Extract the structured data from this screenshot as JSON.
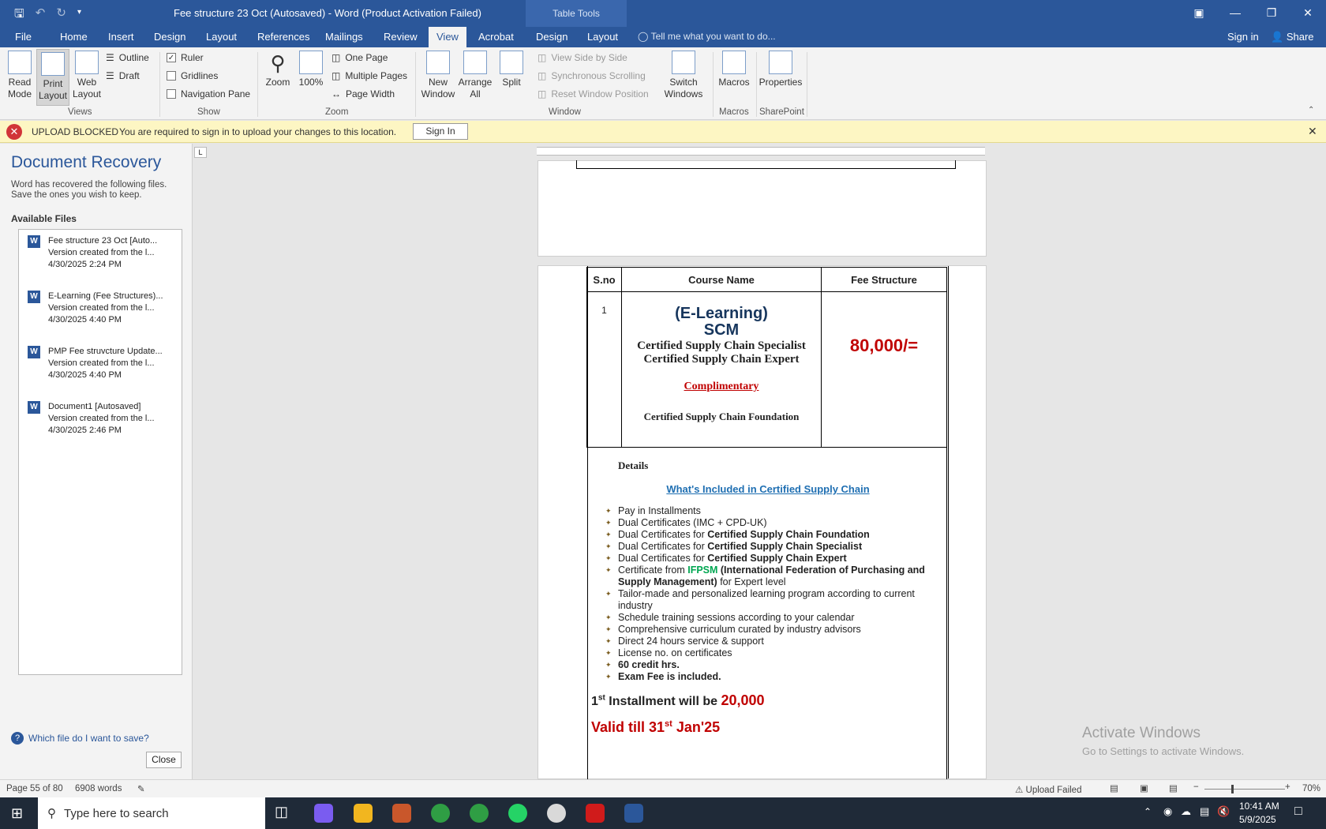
{
  "titlebar": {
    "title": "Fee structure 23 Oct (Autosaved) - Word (Product Activation Failed)",
    "table_tools": "Table Tools"
  },
  "tabs": [
    "File",
    "Home",
    "Insert",
    "Design",
    "Layout",
    "References",
    "Mailings",
    "Review",
    "View",
    "Acrobat",
    "Design",
    "Layout"
  ],
  "tell_me": "Tell me what you want to do...",
  "sign_in": "Sign in",
  "share": "Share",
  "ribbon": {
    "read_mode": "Read Mode",
    "print_layout": "Print Layout",
    "web_layout": "Web Layout",
    "outline": "Outline",
    "draft": "Draft",
    "views": "Views",
    "ruler": "Ruler",
    "gridlines": "Gridlines",
    "nav_pane": "Navigation Pane",
    "show": "Show",
    "zoom": "Zoom",
    "zoom100": "100%",
    "one_page": "One Page",
    "multiple_pages": "Multiple Pages",
    "page_width": "Page Width",
    "zoom_group": "Zoom",
    "new_window": "New Window",
    "arrange_all": "Arrange All",
    "split": "Split",
    "side_by_side": "View Side by Side",
    "sync_scroll": "Synchronous Scrolling",
    "reset_window": "Reset Window Position",
    "switch_windows": "Switch Windows",
    "window": "Window",
    "macros": "Macros",
    "macros_group": "Macros",
    "properties": "Properties",
    "sharepoint": "SharePoint"
  },
  "message_bar": {
    "title": "UPLOAD BLOCKED",
    "text": "You are required to sign in to upload your changes to this location.",
    "button": "Sign In"
  },
  "recovery": {
    "title": "Document Recovery",
    "desc1": "Word has recovered the following files.",
    "desc2": "Save the ones you wish to keep.",
    "available": "Available Files",
    "files": [
      {
        "name": "Fee structure 23 Oct  [Auto...",
        "sub": "Version created from the l...",
        "date": "4/30/2025 2:24 PM"
      },
      {
        "name": "E-Learning (Fee Structures)...",
        "sub": "Version created from the l...",
        "date": "4/30/2025 4:40 PM"
      },
      {
        "name": "PMP Fee struvcture Update...",
        "sub": "Version created from the l...",
        "date": "4/30/2025 4:40 PM"
      },
      {
        "name": "Document1  [Autosaved]",
        "sub": "Version created from the l...",
        "date": "4/30/2025 2:46 PM"
      }
    ],
    "help": "Which file do I want to save?",
    "close": "Close"
  },
  "doc": {
    "h_sno": "S.no",
    "h_course": "Course Name",
    "h_fee": "Fee Structure",
    "sno": "1",
    "el": "(E-Learning)",
    "scm": "SCM",
    "c1": "Certified Supply Chain Specialist",
    "c2": "Certified Supply Chain Expert",
    "compl": "Complimentary",
    "c3": "Certified Supply Chain Foundation",
    "fee": "80,000/=",
    "details": "Details",
    "included": "What's Included in Certified Supply Chain",
    "b1": "Pay in Installments",
    "b2": "Dual Certificates (IMC + CPD-UK)",
    "b3a": "Dual Certificates for ",
    "b3b": "Certified Supply Chain Foundation",
    "b4a": "Dual Certificates for ",
    "b4b": "Certified Supply Chain Specialist",
    "b5a": "Dual Certificates for ",
    "b5b": "Certified Supply Chain Expert",
    "b6a": "Certificate from ",
    "b6b": "IFPSM",
    "b6c": " (International Federation of Purchasing and Supply Management)",
    "b6d": " for Expert level",
    "b7": "Tailor-made and personalized learning program according to current industry",
    "b8": "Schedule training sessions according to your calendar",
    "b9": "Comprehensive curriculum curated by industry advisors",
    "b10": "Direct 24 hours service & support",
    "b11": "License no. on certificates",
    "b12": "60 credit hrs.",
    "b13": "Exam Fee is included.",
    "inst1": "1",
    "inst_sup": "st",
    "inst2": " Installment will be ",
    "inst_amt": "20,000",
    "valid1": "Valid till 31",
    "valid_sup": "st",
    "valid2": " Jan'25"
  },
  "watermark": {
    "line1": "Activate Windows",
    "line2": "Go to Settings to activate Windows."
  },
  "status": {
    "page": "Page 55 of 80",
    "words": "6908 words",
    "upload": "Upload Failed",
    "zoom": "70%",
    "zoom_level_percent": 70
  },
  "taskbar": {
    "search": "Type here to search",
    "time": "10:41 AM",
    "date": "5/9/2025"
  }
}
